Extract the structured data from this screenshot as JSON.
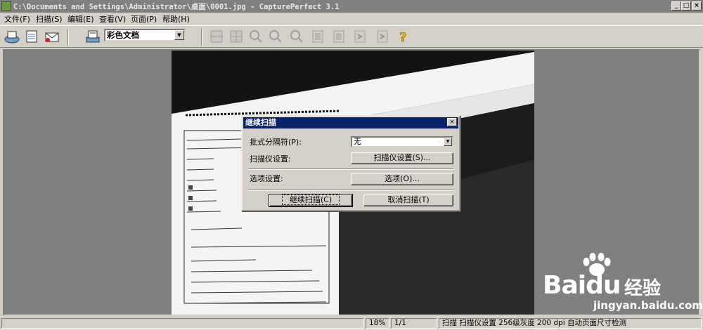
{
  "window": {
    "title": "C:\\Documents and Settings\\Administrator\\桌面\\0001.jpg - CapturePerfect 3.1",
    "minimize": "_",
    "maximize": "□",
    "close": "×"
  },
  "menu": [
    {
      "label": "文件(F)"
    },
    {
      "label": "扫描(S)"
    },
    {
      "label": "编辑(E)"
    },
    {
      "label": "查看(V)"
    },
    {
      "label": "页面(P)"
    },
    {
      "label": "帮助(H)"
    }
  ],
  "toolbar": {
    "mode_select": "彩色文档"
  },
  "dialog": {
    "title": "继续扫描",
    "separator_label": "批式分隔符(P):",
    "separator_value": "无",
    "scanner_settings_label": "扫描仪设置:",
    "scanner_settings_button": "扫描仪设置(S)...",
    "options_label": "选项设置:",
    "options_button": "选项(O)...",
    "continue_button": "继续扫描(C)",
    "cancel_button": "取消扫描(T)",
    "close": "×"
  },
  "status": {
    "zoom": "18%",
    "page": "1/1",
    "info": "扫描 扫描仪设置  256级灰度  200 dpi  自动页面尺寸检测"
  },
  "watermark": {
    "brand": "Bai",
    "brand2": "du",
    "cn": "经验",
    "url": "jingyan.baidu.com"
  },
  "colors": {
    "titlebar_inactive": "#808080",
    "dialog_title_active": "#0a246a",
    "workspace": "#808080",
    "window_face": "#d4d0c8"
  }
}
